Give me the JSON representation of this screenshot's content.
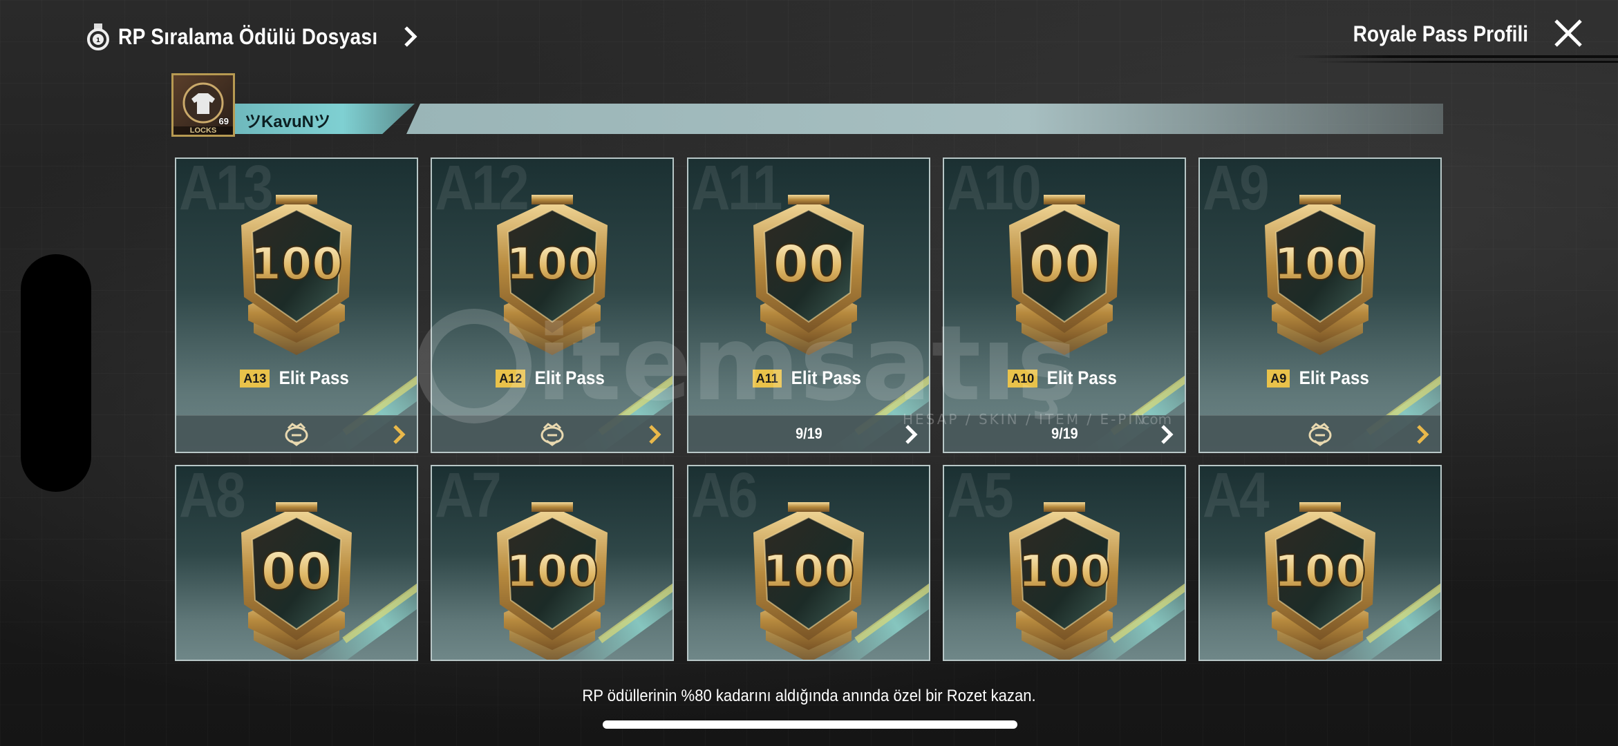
{
  "header": {
    "title": "RP Sıralama Ödülü Dosyası",
    "right_label": "Royale Pass Profili"
  },
  "player": {
    "name": "ツKavuNツ",
    "level": "69",
    "frame_text": "LOCKS"
  },
  "cards": [
    {
      "season": "A13",
      "badge_number": "100",
      "tag": "A13",
      "label": "Elit Pass",
      "footer_type": "icon",
      "footer_text": ""
    },
    {
      "season": "A12",
      "badge_number": "100",
      "tag": "A12",
      "label": "Elit Pass",
      "footer_type": "icon",
      "footer_text": ""
    },
    {
      "season": "A11",
      "badge_number": "00",
      "tag": "A11",
      "label": "Elit Pass",
      "footer_type": "progress",
      "footer_text": "9/19"
    },
    {
      "season": "A10",
      "badge_number": "00",
      "tag": "A10",
      "label": "Elit Pass",
      "footer_type": "progress",
      "footer_text": "9/19"
    },
    {
      "season": "A9",
      "badge_number": "100",
      "tag": "A9",
      "label": "Elit Pass",
      "footer_type": "icon",
      "footer_text": ""
    },
    {
      "season": "A8",
      "badge_number": "00"
    },
    {
      "season": "A7",
      "badge_number": "100"
    },
    {
      "season": "A6",
      "badge_number": "100"
    },
    {
      "season": "A5",
      "badge_number": "100"
    },
    {
      "season": "A4",
      "badge_number": "100"
    }
  ],
  "footer_hint": "RP ödüllerinin %80 kadarını aldığında anında özel bir Rozet kazan.",
  "watermark": {
    "brand": "itemsatış",
    "sub": "HESAP / SKIN / ITEM / E-PIN",
    "suffix": ".com"
  },
  "colors": {
    "accent_teal": "#7fd0d2",
    "season_tag": "#e9c24a",
    "badge_gold": "#c9a24e"
  },
  "icons": {
    "header_left": "medal-icon",
    "header_chevron": "chevron-right-icon",
    "close": "close-icon",
    "card_footer_icon": "rank-emblem-icon",
    "card_footer_chevron": "chevron-right-icon"
  }
}
